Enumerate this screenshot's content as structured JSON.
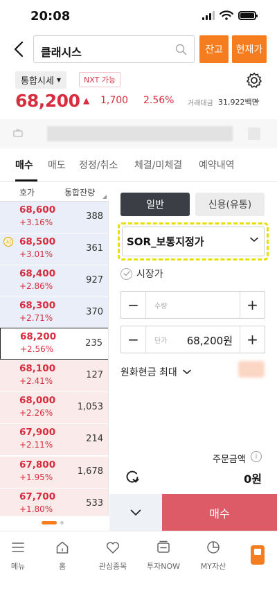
{
  "status": {
    "time": "20:08"
  },
  "header": {
    "search_value": "클래시스",
    "balance_btn": "잔고",
    "current_price_btn": "현재가"
  },
  "quote": {
    "market": "통합시세",
    "nxt": "NXT 가능",
    "price": "68,200",
    "change": "1,700",
    "change_rate": "2.56%",
    "volume_label": "거래대금",
    "volume_value": "31,922백만"
  },
  "tabs": [
    "매수",
    "매도",
    "정정/취소",
    "체결/미체결",
    "예약내역"
  ],
  "orderbook": {
    "col_price": "호가",
    "col_qty": "통합잔량",
    "rows": [
      {
        "price": "68,600",
        "rate": "+3.16%",
        "qty": "388",
        "side": "ask"
      },
      {
        "price": "68,500",
        "rate": "+3.01%",
        "qty": "361",
        "side": "ask",
        "badge": "시"
      },
      {
        "price": "68,400",
        "rate": "+2.86%",
        "qty": "927",
        "side": "ask"
      },
      {
        "price": "68,300",
        "rate": "+2.71%",
        "qty": "370",
        "side": "ask"
      },
      {
        "price": "68,200",
        "rate": "+2.56%",
        "qty": "235",
        "side": "cur"
      },
      {
        "price": "68,100",
        "rate": "+2.41%",
        "qty": "127",
        "side": "bid"
      },
      {
        "price": "68,000",
        "rate": "+2.26%",
        "qty": "1,053",
        "side": "bid"
      },
      {
        "price": "67,900",
        "rate": "+2.11%",
        "qty": "214",
        "side": "bid"
      },
      {
        "price": "67,800",
        "rate": "+1.95%",
        "qty": "1,678",
        "side": "bid"
      },
      {
        "price": "67,700",
        "rate": "+1.80%",
        "qty": "533",
        "side": "bid"
      }
    ]
  },
  "order": {
    "toggle_general": "일반",
    "toggle_credit": "신용(유통)",
    "order_type": "SOR_보통지정가",
    "market_price": "시장가",
    "qty_placeholder": "수량",
    "price_placeholder": "단가",
    "price_value": "68,200원",
    "max_label": "원화현금 최대",
    "amount_label": "주문금액",
    "amount_value": "0원",
    "buy_btn": "매수"
  },
  "nav": [
    "메뉴",
    "홈",
    "관심종목",
    "투자NOW",
    "MY자산"
  ],
  "colors": {
    "accent": "#f57c1f",
    "up": "#d62d3f",
    "buy": "#dd5b67"
  }
}
